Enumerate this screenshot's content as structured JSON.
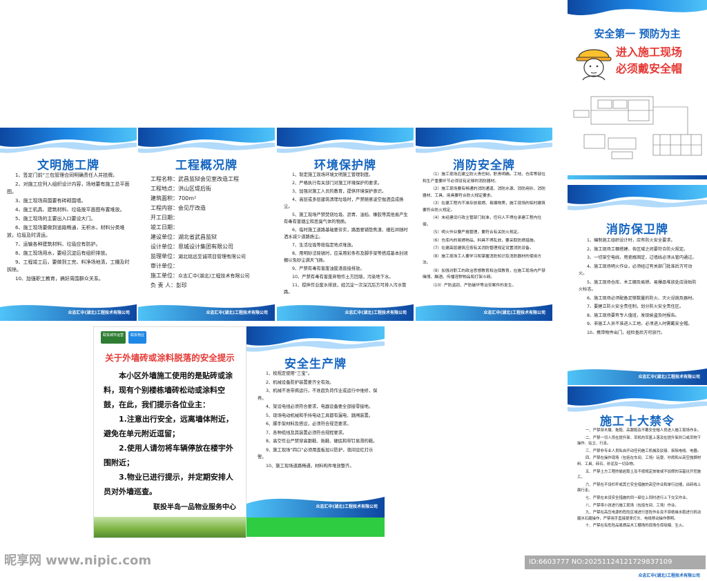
{
  "boards": {
    "wenming": {
      "title": "文明施工牌",
      "items": [
        "1、签定门前“三包管理合同明确责任人并挂牌。",
        "2、对施工应列入组织设计内容，场地要有施工总平面图。",
        "3、施工现场周围要有砖砌围墙。",
        "4、施工机具、建筑材料、垃圾按平面图布置堆放。",
        "5、施工现场的主要出入口要设大门。",
        "6、施工现场要做到道路畅通，无积水，材料分类堆放，垃圾及时清运。",
        "7、运输各种建筑材料、垃圾应有防护。",
        "8、施工现场用水，要经沉淀后有组织排放。",
        "9、工程竣工后，要做到工完、料净场地清，工棚及时拆除。",
        "10、加强职工教育，搞好周围群众关系。"
      ],
      "footer": "众志汇中(湖北)工程技术有限公司"
    },
    "gaikuang": {
      "title": "工程概况牌",
      "rows": [
        {
          "k": "工程名称：",
          "v": "武昌监狱会见室改造工程"
        },
        {
          "k": "工程地点：",
          "v": "洪山区堤后街"
        },
        {
          "k": "建筑面积：",
          "v": "700m²"
        },
        {
          "k": "工程内容：",
          "v": "会见厅改造"
        },
        {
          "k": "开工日期：",
          "v": ""
        },
        {
          "k": "竣工日期：",
          "v": ""
        },
        {
          "k": "建设单位：",
          "v": "湖北省武昌监狱"
        },
        {
          "k": "设计单位：",
          "v": "思城设计集团有限公司"
        },
        {
          "k": "监理单位：",
          "v": "湖北铭远至诚项目管理有限公司"
        },
        {
          "k": "审计单位：",
          "v": ""
        },
        {
          "k": "施工单位：",
          "v": "众志汇中(湖北)工程技术有限公司"
        },
        {
          "k": "负 责 人：",
          "v": "彭珍"
        }
      ],
      "footer": "众志汇中(湖北)工程技术有限公司"
    },
    "huanjing": {
      "title": "环境保护牌",
      "items": [
        "1、制定施工现场环境文明施工管理制度。",
        "2、严格执行有关部门对施工环境保护的要求。",
        "3、加强对施工人员的教育，提供环境保护意识。",
        "4、高层或多层建筑清理垃圾时，严禁随意凌空抛洒造成扬尘。",
        "5、施工现场严禁焚烧垃圾、沥青、油毡、橡胶等其他易产生有毒有害烟尘和恶臭气体的物质。",
        "6、临时施工道路基础要夯实，路面要铺垫焦渣、细石并随时洒水减少道路扬尘。",
        "7、生活垃圾等按指定地点堆放。",
        "8、用明砂法除锈时，应采用彩条布及脚手架等搭成基本封闭棚以免砂尘满天飞扬。",
        "9、严禁有毒有害废油废渣直接排放。",
        "10、严禁有毒有害废弃物作土方回填，污染地下水。",
        "11、搅拌作业废水排放，经沉淀一次深沉后方可排入污水管路。"
      ],
      "footer": "众志汇中(湖北)工程技术有限公司"
    },
    "xiaofang": {
      "title": "消防安全牌",
      "items": [
        "（1）施工现场应建立防火责任制，职责明确。工地、仓库等部位和生产重要环节必须设有足够的消防器材。",
        "（2）施工现场要有畅通的消防通道、消防水源、消防用砂、消防器材、工具、用具要符合防火规定要求。",
        "（3）在建工程内不准存放易燃、易爆物质，施工现场的临时建筑要符合防火规定。",
        "（4）未经建设行政主管部门批准，任何人不得在承建工程内住宿。",
        "（5）明火作业要严格管理，要符合有关防火规定。",
        "（6）仓库内的易燃物品、料具不得乱放，要采取防燃措施。",
        "（7）在建高层建筑应按有关消防管理规定设置消防设备。",
        "（8）施工现场工人要学习和掌握消防知识及消防器材的使用方法。",
        "（9）加强对职工的政治思想教育和治保教育，在施工现场内严禁赌博、酗酒、传播淫秽物品和打架斗殴。",
        "（10）严防盗窃、严防破坏等治安案件的发生。"
      ],
      "footer": "众志汇中(湖北)工程技术有限公司"
    },
    "anquan": {
      "title": "安全生产牌",
      "items": [
        "1、按规定使用“三宝”。",
        "2、机械设备防护装置要齐全有效。",
        "3、机械不准带病运行，不准超负荷作业或运行中维修，保养。",
        "4、架设电线必须符合要求，电器设备要全部接零接地。",
        "5、现场电动机械和手持电动工具都有漏电、跳闸装置。",
        "6、脚手架材料及搭设，必须符合规范要求。",
        "7、各种缆线及其装置必须符合规程要求。",
        "8、高空作业严禁穿高跟鞋、拖鞋、硬底和带钉易滑的鞋。",
        "9、施工现场“四口”必须用盖板加以防护，夜间设红灯示警。",
        "10、施工现场道路畅通，材料构件堆放整齐。"
      ],
      "footer": "众志汇中(湖北)工程技术有限公司"
    },
    "xiaofangbaowei": {
      "title": "消防保卫牌",
      "items": [
        "1、编制施工组织设计时，应有防火安全要求。",
        "2、施工现场工棚搭建、各区域之间要符合防火规定。",
        "3、一切架空电线，用瓷瓶固定，过墙线必须从管内通过。",
        "4、施工现场明火作业，必须经过有关部门批准后方可动火。",
        "5、施工现场仓库、木工棚及易燃、易爆品堆放处应张贴防火标志。",
        "6、施工现场必须配备足够数量的防火、灭火设施及器材。",
        "7、要建立防火安全责任制，划分防火安全责任区。",
        "8、施工现场要有专人值班，发现偷盗及时报告。",
        "9、非施工人员不准进入工地，必须进入时需戴安全帽。",
        "10、携带物件出门，经检查后方可放行。"
      ],
      "footer": "众志汇中(湖北)工程技术有限公司"
    },
    "jinling": {
      "title": "施工十大禁令",
      "items": [
        "一、严禁穿木屐、拖鞋、高跟鞋及不戴安全帽人员进入施工现场作业。",
        "二、严禁一切人员在提升架、吊机的吊篮上落及在提升架井口或吊物下操作、站立、行走。",
        "三、严禁非专业人员私自开动任何施工机械及驳接、拆除电线、电器。",
        "四、严禁在操作现场（包括在车间、工场）玩耍、吵闹和从高空抛掷材料、工具、砖石、砂泥及一切杂物。",
        "五、严禁土方工程的偷岩取土及不按规定放坡或不加撑的深基坑开挖施工。",
        "六、严禁在不设栏杆或其它安全措施的高空作业和单行边墙，出砖线上面行走。",
        "七、严禁在未设安全措施的同一部位上同时进行上下交叉作业。",
        "八、严禁带小孩进行施工现场（包括车间、工场）作业。",
        "九、严禁在高压电源的危险区域进行冒险作业及不穿绝缘水鞋进行机动磨水石磨操作，严禁用手直接提拿灯头、电线移动操作照明。",
        "十、严禁在有危险品易燃品木工棚场的现场仓库吸烟、生火。"
      ],
      "footer": "众志汇中(湖北)工程技术有限公司"
    }
  },
  "poster": {
    "line1": "安全第一  预防为主",
    "line2": "进入施工现场",
    "line3": "必须戴安全帽"
  },
  "notice": {
    "logo1": "联投城市运营",
    "logo2": "联投物业",
    "title": "关于外墙砖或涂料脱落的安全提示",
    "paragraphs": [
      "本小区外墙施工使用的是贴砖或涂料，现有个别楼栋墙砖松动或涂料空鼓，在此，我们提示各位业主：",
      "1.注意出行安全，远离墙体附近，避免在单元附近逗留；",
      "2.使用人请勿将车辆停放在楼宇外围附近；",
      "3.物业已进行提示，并定期安排人员对外墙巡查。"
    ],
    "sign": "联投半岛一品物业服务中心"
  },
  "watermark": {
    "left": "昵享网 www.nipic.com",
    "id": "ID:6603777 NO:20251124121729837109"
  },
  "colors": {
    "title_blue": "#1565c0",
    "wave_blue": "#1e88e5",
    "notice_red": "#e53935",
    "grass_green": "#7cb342"
  }
}
